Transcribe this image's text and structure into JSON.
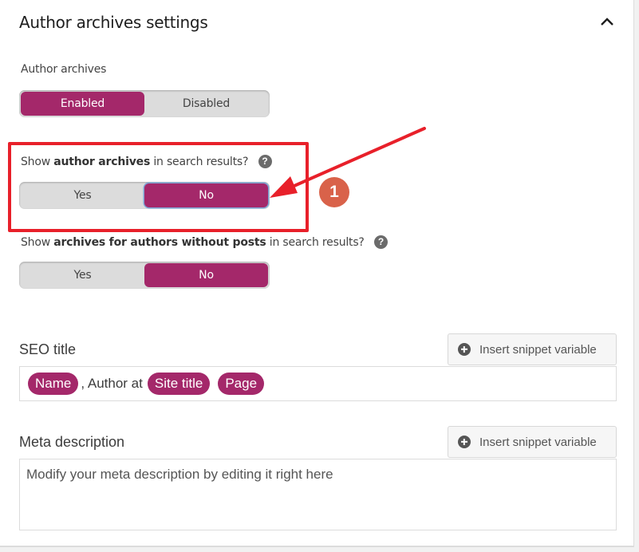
{
  "section": {
    "title": "Author archives settings",
    "collapse_icon": "chevron-up-icon"
  },
  "author_archives": {
    "label": "Author archives",
    "options": [
      "Enabled",
      "Disabled"
    ],
    "selected": "Enabled"
  },
  "show_in_search": {
    "label_prefix": "Show ",
    "label_bold": "author archives",
    "label_suffix": " in search results?",
    "help_icon": "?",
    "options": [
      "Yes",
      "No"
    ],
    "selected": "No"
  },
  "show_without_posts": {
    "label_prefix": "Show ",
    "label_bold": "archives for authors without posts",
    "label_suffix": " in search results?",
    "help_icon": "?",
    "options": [
      "Yes",
      "No"
    ],
    "selected": "No"
  },
  "annotation": {
    "badge": "1",
    "color": "#e8202a",
    "badge_color": "#d9624a"
  },
  "seo_title": {
    "label": "SEO title",
    "insert_button": "Insert snippet variable",
    "value": {
      "pill_1": "Name",
      "text": ", Author at",
      "pill_2": "Site title",
      "pill_3": "Page"
    }
  },
  "meta_description": {
    "label": "Meta description",
    "insert_button": "Insert snippet variable",
    "placeholder": "Modify your meta description by editing it right here"
  },
  "colors": {
    "accent": "#a4286a",
    "toggle_bg": "#dcdcdc"
  }
}
